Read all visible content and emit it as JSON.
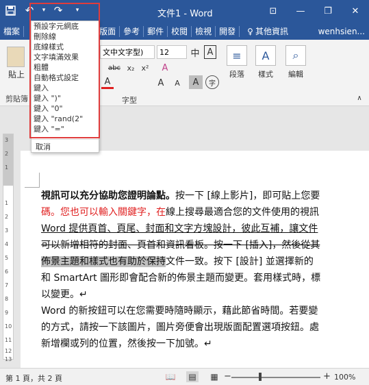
{
  "window": {
    "title": "文件1 - Word"
  },
  "qat": {
    "undo_arrow": "▾",
    "customize": "▾"
  },
  "tabs": [
    "檔案",
    "常用",
    "插入",
    "設計",
    "版面",
    "參考",
    "郵件",
    "校閱",
    "檢視",
    "開發"
  ],
  "tell_me": "其他資訊",
  "user": "wenhsien...",
  "ribbon": {
    "font_name": "文中文字型)",
    "font_size": "12",
    "paste_label": "貼上",
    "clipboard_label": "剪貼簿",
    "font_group_label": "字型",
    "paragraph_label": "段落",
    "styles_label": "樣式",
    "editing_label": "編輯"
  },
  "undo_menu": {
    "items": [
      "預設字元網底",
      "刪除線",
      "底線樣式",
      "文字填滿效果",
      "粗體",
      "自動格式設定",
      "鍵入",
      "鍵入 \")\"",
      "鍵入 \"0\"",
      "鍵入 \"rand(2\"",
      "鍵入 \"=\""
    ],
    "cancel": "取消"
  },
  "document": {
    "lines": [
      {
        "a": "視訊可以充分協助您證明論點。",
        "b": "按一下 [線上影片]，即可貼上您要"
      },
      {
        "a": "碼。您也可以輸入關鍵字，在",
        "b": "線上搜尋最適合您的文件使用的視訊"
      },
      {
        "a": "Word 提供頁首、頁尾、封面和文字方塊設計，彼此互補，讓文件"
      },
      {
        "a": "可以新增相符的封面、頁首和資訊看板。按一下 [插入]，然後從其"
      },
      {
        "a": "佈景主題和樣式也有助於保持",
        "b": "文件一致。按下 [設計] 並選擇新的"
      },
      {
        "a": "和 SmartArt 圖形即會配合新的佈景主題而變更。套用樣式時，標"
      },
      {
        "a": "以變更。↵"
      },
      {
        "a": "Word 的新按鈕可以在您需要時隨時顯示，藉此節省時間。若要變"
      },
      {
        "a": "的方式，請按一下該圖片，圖片旁便會出現版面配置選項按鈕。處"
      },
      {
        "a": "新增欄或列的位置，然後按一下加號。↵"
      }
    ]
  },
  "status": {
    "page": "第 1 頁，共 2 頁",
    "zoom": "100%"
  },
  "ruler_numbers": [
    "3",
    "2",
    "1",
    "1",
    "2",
    "3",
    "4",
    "5",
    "6",
    "7",
    "8",
    "9",
    "10",
    "11",
    "12",
    "13"
  ]
}
